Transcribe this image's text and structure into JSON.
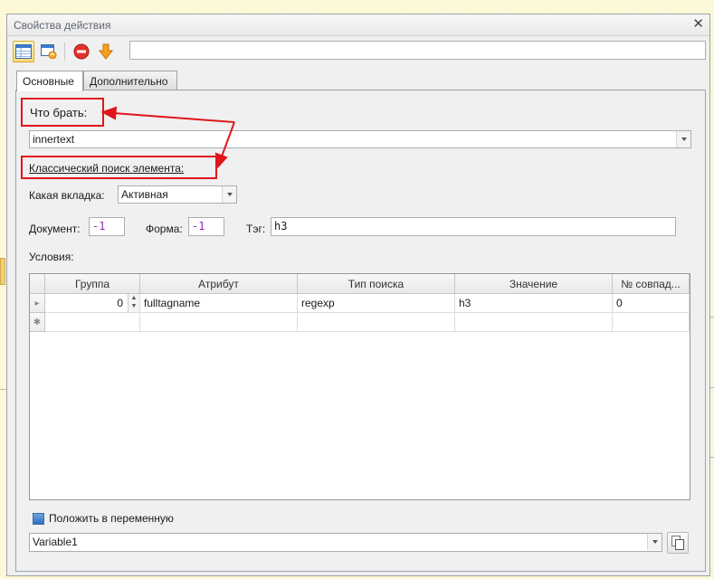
{
  "window": {
    "title": "Свойства действия"
  },
  "toolbar": {
    "field_value": ""
  },
  "tabs": [
    {
      "label": "Основные"
    },
    {
      "label": "Дополнительно"
    }
  ],
  "form": {
    "what_to_take_label": "Что брать:",
    "what_to_take_value": "innertext",
    "classic_search_label": "Классический поиск элемента:",
    "tab_label": "Какая вкладка:",
    "tab_value": "Активная",
    "document_label": "Документ:",
    "document_value": "-1",
    "form_label": "Форма:",
    "form_value": "-1",
    "tag_label": "Тэг:",
    "tag_value": "h3",
    "conditions_label": "Условия:"
  },
  "grid": {
    "columns": [
      "Группа",
      "Атрибут",
      "Тип поиска",
      "Значение",
      "№ совпад..."
    ],
    "rows": [
      [
        "0",
        "fulltagname",
        "regexp",
        "h3",
        "0"
      ]
    ]
  },
  "save": {
    "checkbox_label": "Положить в переменную",
    "variable_value": "Variable1"
  },
  "colors": {
    "highlight": "#e0161b",
    "accent": "#2f6fc0"
  }
}
